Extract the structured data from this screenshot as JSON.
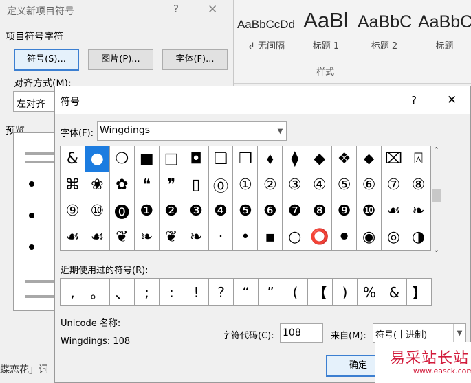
{
  "back_dialog": {
    "title": "定义新项目符号",
    "help": "?",
    "close": "✕",
    "section_label": "项目符号字符",
    "symbol_button": "符号(S)...",
    "picture_button": "图片(P)...",
    "font_button": "字体(F)...",
    "align_label": "对齐方式(M):",
    "align_value": "左对齐",
    "preview_label": "预览",
    "bottom_text": "蝶恋花」词"
  },
  "ribbon": {
    "styles": [
      {
        "preview": "AaBbCcDd",
        "name": "↲ 无间隔"
      },
      {
        "preview": "AaBl",
        "name": "标题 1"
      },
      {
        "preview": "AaBbC",
        "name": "标题 2"
      },
      {
        "preview": "AaBbC",
        "name": "标题"
      }
    ],
    "group_label": "样式"
  },
  "symbol_dialog": {
    "title": "符号",
    "help": "?",
    "close": "✕",
    "font_label": "字体(F):",
    "font_value": "Wingdings",
    "grid_rows": [
      [
        "&",
        "●",
        "❍",
        "■",
        "□",
        "◘",
        "❑",
        "❒",
        "⬧",
        "⧫",
        "◆",
        "❖",
        "⬥",
        "⌧",
        "⍓"
      ],
      [
        "⌘",
        "❀",
        "✿",
        "❝",
        "❞",
        "▯",
        "⓪",
        "①",
        "②",
        "③",
        "④",
        "⑤",
        "⑥",
        "⑦",
        "⑧"
      ],
      [
        "⑨",
        "⑩",
        "⓿",
        "❶",
        "❷",
        "❸",
        "❹",
        "❺",
        "❻",
        "❼",
        "❽",
        "❾",
        "❿",
        "☙",
        "❧"
      ],
      [
        "☙",
        "☙",
        "❦",
        "❧",
        "❦",
        "❧",
        "·",
        "•",
        "▪",
        "○",
        "⭕",
        "⚫",
        "◉",
        "◎",
        "◑"
      ]
    ],
    "recent_label": "近期使用过的符号(R):",
    "recent_symbols": [
      ",",
      "。",
      "、",
      ";",
      ":",
      "!",
      "?",
      "“",
      "”",
      "(",
      "【",
      ")",
      "%",
      "&",
      "】"
    ],
    "unicode_label": "Unicode 名称:",
    "glyph_info": "Wingdings: 108",
    "charcode_label": "字符代码(C):",
    "charcode_value": "108",
    "from_label": "来自(M):",
    "from_value": "符号(十进制)",
    "ok_button": "确定"
  },
  "watermark": {
    "text": "易采站长站",
    "url": "www.easck.com"
  }
}
